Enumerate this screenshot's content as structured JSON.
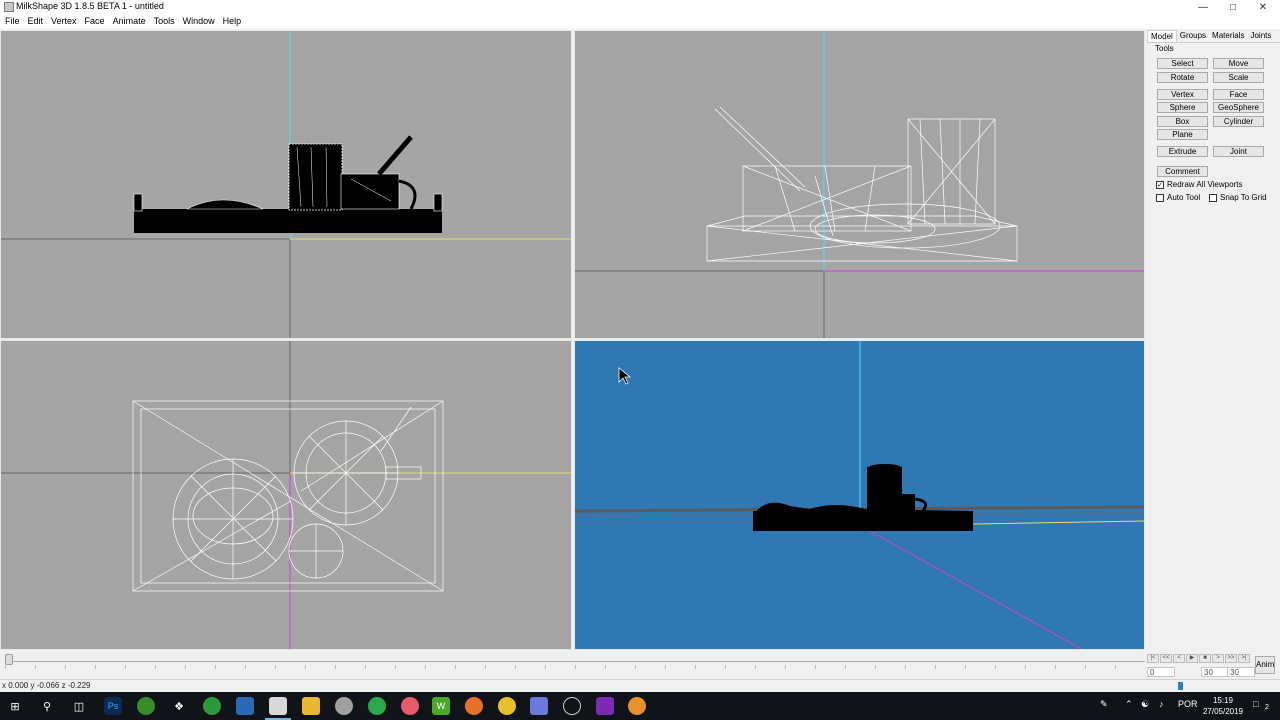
{
  "window": {
    "title": "MilkShape 3D 1.8.5 BETA 1 - untitled",
    "controls": [
      "minimize-icon",
      "maximize-icon",
      "close-icon"
    ]
  },
  "menu": [
    "File",
    "Edit",
    "Vertex",
    "Face",
    "Animate",
    "Tools",
    "Window",
    "Help"
  ],
  "viewports": [
    {
      "name": "front",
      "style": "wireframe"
    },
    {
      "name": "side",
      "style": "wireframe"
    },
    {
      "name": "top",
      "style": "wireframe"
    },
    {
      "name": "3d",
      "style": "shaded",
      "background": "#3078b4"
    }
  ],
  "panel": {
    "tabs": [
      "Model",
      "Groups",
      "Materials",
      "Joints"
    ],
    "active_tab": "Model",
    "tools_label": "Tools",
    "buttons": {
      "select": "Select",
      "move": "Move",
      "rotate": "Rotate",
      "scale": "Scale",
      "vertex": "Vertex",
      "face": "Face",
      "sphere": "Sphere",
      "geosphere": "GeoSphere",
      "box": "Box",
      "cylinder": "Cylinder",
      "plane": "Plane",
      "extrude": "Extrude",
      "joint": "Joint",
      "comment": "Comment"
    },
    "checkboxes": {
      "redraw_all": {
        "label": "Redraw All Viewports",
        "checked": true
      },
      "auto_tool": {
        "label": "Auto Tool",
        "checked": false
      },
      "snap_to_grid": {
        "label": "Snap To Grid",
        "checked": false
      }
    }
  },
  "timeline": {
    "start_frame": "0",
    "field_a": "30",
    "field_b": "30",
    "anim_label": "Anim"
  },
  "status": {
    "coords": "x 0.000 y -0.066 z -0.229"
  },
  "taskbar": {
    "language": "POR",
    "time": "15:19",
    "date": "27/05/2019",
    "notification_count": "2"
  },
  "colors": {
    "viewport_bg": "#a5a5a5",
    "viewport_3d_bg": "#3078b4",
    "axis_x": "#e0e070",
    "axis_y": "#50e0f0",
    "axis_z": "#d040d0"
  }
}
